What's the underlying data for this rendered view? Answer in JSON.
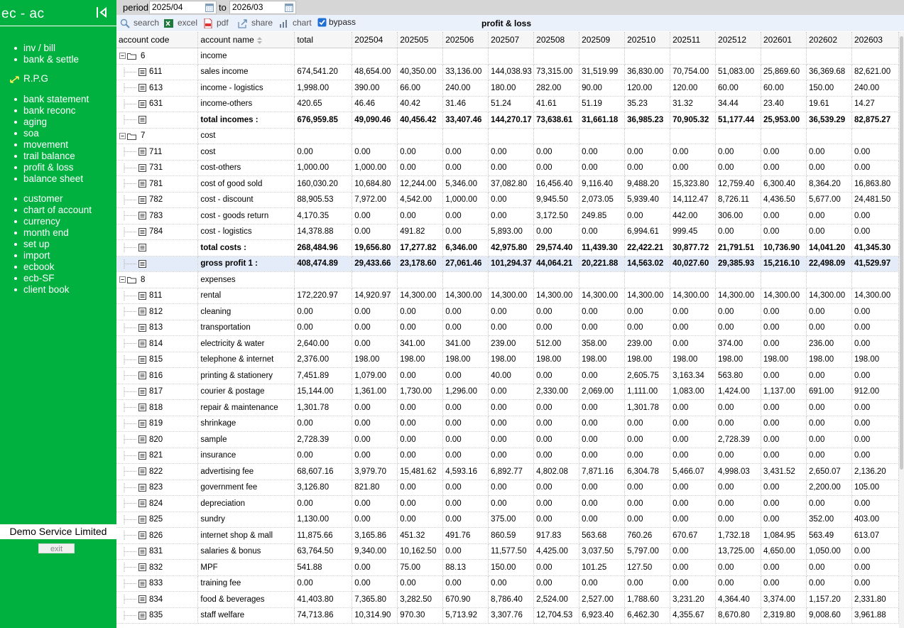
{
  "app": {
    "title": "ec - ac",
    "company": "Demo Service Limited",
    "exit_label": "exit"
  },
  "menu_groups": [
    [
      "inv / bill",
      "bank & settle"
    ],
    [
      "R.P.G"
    ],
    [
      "bank statement",
      "bank reconc",
      "aging",
      "soa",
      "movement",
      "trail balance",
      "profit & loss",
      "balance sheet"
    ],
    [
      "customer",
      "chart of account",
      "currency",
      "month end",
      "set up",
      "import",
      "ecbook",
      "ecb-SF",
      "client book"
    ]
  ],
  "filter": {
    "period_label": "period",
    "from": "2025/04",
    "to_label": "to",
    "to": "2026/03"
  },
  "toolbar": {
    "search": "search",
    "excel": "excel",
    "pdf": "pdf",
    "share": "share",
    "chart": "chart",
    "bypass": "bypass",
    "bypass_checked": true
  },
  "report_title": "profit & loss",
  "columns": [
    "account code",
    "account name",
    "total",
    "202504",
    "202505",
    "202506",
    "202507",
    "202508",
    "202509",
    "202510",
    "202511",
    "202512",
    "202601",
    "202602",
    "202603"
  ],
  "rows": [
    {
      "type": "group",
      "code": "6",
      "name": "income",
      "values": []
    },
    {
      "type": "account",
      "code": "611",
      "name": "sales income",
      "values": [
        "674,541.20",
        "48,654.00",
        "40,350.00",
        "33,136.00",
        "144,038.93",
        "73,315.00",
        "31,519.99",
        "36,830.00",
        "70,754.00",
        "51,083.00",
        "25,869.60",
        "36,369.68",
        "82,621.00"
      ]
    },
    {
      "type": "account",
      "code": "613",
      "name": "income - logistics",
      "values": [
        "1,998.00",
        "390.00",
        "66.00",
        "240.00",
        "180.00",
        "282.00",
        "90.00",
        "120.00",
        "120.00",
        "60.00",
        "60.00",
        "150.00",
        "240.00"
      ]
    },
    {
      "type": "account",
      "code": "631",
      "name": "income-others",
      "values": [
        "420.65",
        "46.46",
        "40.42",
        "31.46",
        "51.24",
        "41.61",
        "51.19",
        "35.23",
        "31.32",
        "34.44",
        "23.40",
        "19.61",
        "14.27"
      ]
    },
    {
      "type": "total",
      "code": "",
      "name": "total incomes :",
      "values": [
        "676,959.85",
        "49,090.46",
        "40,456.42",
        "33,407.46",
        "144,270.17",
        "73,638.61",
        "31,661.18",
        "36,985.23",
        "70,905.32",
        "51,177.44",
        "25,953.00",
        "36,539.29",
        "82,875.27"
      ]
    },
    {
      "type": "group",
      "code": "7",
      "name": "cost",
      "values": []
    },
    {
      "type": "account",
      "code": "711",
      "name": "cost",
      "values": [
        "0.00",
        "0.00",
        "0.00",
        "0.00",
        "0.00",
        "0.00",
        "0.00",
        "0.00",
        "0.00",
        "0.00",
        "0.00",
        "0.00",
        "0.00"
      ]
    },
    {
      "type": "account",
      "code": "731",
      "name": "cost-others",
      "values": [
        "1,000.00",
        "1,000.00",
        "0.00",
        "0.00",
        "0.00",
        "0.00",
        "0.00",
        "0.00",
        "0.00",
        "0.00",
        "0.00",
        "0.00",
        "0.00"
      ]
    },
    {
      "type": "account",
      "code": "781",
      "name": "cost of good sold",
      "values": [
        "160,030.20",
        "10,684.80",
        "12,244.00",
        "5,346.00",
        "37,082.80",
        "16,456.40",
        "9,116.40",
        "9,488.20",
        "15,323.80",
        "12,759.40",
        "6,300.40",
        "8,364.20",
        "16,863.80"
      ]
    },
    {
      "type": "account",
      "code": "782",
      "name": "cost - discount",
      "values": [
        "88,905.53",
        "7,972.00",
        "4,542.00",
        "1,000.00",
        "0.00",
        "9,945.50",
        "2,073.05",
        "5,939.40",
        "14,112.47",
        "8,726.11",
        "4,436.50",
        "5,677.00",
        "24,481.50"
      ]
    },
    {
      "type": "account",
      "code": "783",
      "name": "cost - goods return",
      "values": [
        "4,170.35",
        "0.00",
        "0.00",
        "0.00",
        "0.00",
        "3,172.50",
        "249.85",
        "0.00",
        "442.00",
        "306.00",
        "0.00",
        "0.00",
        "0.00"
      ]
    },
    {
      "type": "account",
      "code": "784",
      "name": "cost - logistics",
      "values": [
        "14,378.88",
        "0.00",
        "491.82",
        "0.00",
        "5,893.00",
        "0.00",
        "0.00",
        "6,994.61",
        "999.45",
        "0.00",
        "0.00",
        "0.00",
        "0.00"
      ]
    },
    {
      "type": "total",
      "code": "",
      "name": "total costs :",
      "values": [
        "268,484.96",
        "19,656.80",
        "17,277.82",
        "6,346.00",
        "42,975.80",
        "29,574.40",
        "11,439.30",
        "22,422.21",
        "30,877.72",
        "21,791.51",
        "10,736.90",
        "14,041.20",
        "41,345.30"
      ]
    },
    {
      "type": "gross",
      "code": "",
      "name": "gross profit 1 :",
      "values": [
        "408,474.89",
        "29,433.66",
        "23,178.60",
        "27,061.46",
        "101,294.37",
        "44,064.21",
        "20,221.88",
        "14,563.02",
        "40,027.60",
        "29,385.93",
        "15,216.10",
        "22,498.09",
        "41,529.97"
      ]
    },
    {
      "type": "group",
      "code": "8",
      "name": "expenses",
      "values": []
    },
    {
      "type": "account",
      "code": "811",
      "name": "rental",
      "values": [
        "172,220.97",
        "14,920.97",
        "14,300.00",
        "14,300.00",
        "14,300.00",
        "14,300.00",
        "14,300.00",
        "14,300.00",
        "14,300.00",
        "14,300.00",
        "14,300.00",
        "14,300.00",
        "14,300.00"
      ]
    },
    {
      "type": "account",
      "code": "812",
      "name": "cleaning",
      "values": [
        "0.00",
        "0.00",
        "0.00",
        "0.00",
        "0.00",
        "0.00",
        "0.00",
        "0.00",
        "0.00",
        "0.00",
        "0.00",
        "0.00",
        "0.00"
      ]
    },
    {
      "type": "account",
      "code": "813",
      "name": "transportation",
      "values": [
        "0.00",
        "0.00",
        "0.00",
        "0.00",
        "0.00",
        "0.00",
        "0.00",
        "0.00",
        "0.00",
        "0.00",
        "0.00",
        "0.00",
        "0.00"
      ]
    },
    {
      "type": "account",
      "code": "814",
      "name": "electricity & water",
      "values": [
        "2,640.00",
        "0.00",
        "341.00",
        "341.00",
        "239.00",
        "512.00",
        "358.00",
        "239.00",
        "0.00",
        "374.00",
        "0.00",
        "236.00",
        "0.00"
      ]
    },
    {
      "type": "account",
      "code": "815",
      "name": "telephone & internet",
      "values": [
        "2,376.00",
        "198.00",
        "198.00",
        "198.00",
        "198.00",
        "198.00",
        "198.00",
        "198.00",
        "198.00",
        "198.00",
        "198.00",
        "198.00",
        "198.00"
      ]
    },
    {
      "type": "account",
      "code": "816",
      "name": "printing & stationery",
      "values": [
        "7,451.89",
        "1,079.00",
        "0.00",
        "0.00",
        "40.00",
        "0.00",
        "0.00",
        "2,605.75",
        "3,163.34",
        "563.80",
        "0.00",
        "0.00",
        "0.00"
      ]
    },
    {
      "type": "account",
      "code": "817",
      "name": "courier & postage",
      "values": [
        "15,144.00",
        "1,361.00",
        "1,730.00",
        "1,296.00",
        "0.00",
        "2,330.00",
        "2,069.00",
        "1,111.00",
        "1,083.00",
        "1,424.00",
        "1,137.00",
        "691.00",
        "912.00"
      ]
    },
    {
      "type": "account",
      "code": "818",
      "name": "repair & maintenance",
      "values": [
        "1,301.78",
        "0.00",
        "0.00",
        "0.00",
        "0.00",
        "0.00",
        "0.00",
        "1,301.78",
        "0.00",
        "0.00",
        "0.00",
        "0.00",
        "0.00"
      ]
    },
    {
      "type": "account",
      "code": "819",
      "name": "shrinkage",
      "values": [
        "0.00",
        "0.00",
        "0.00",
        "0.00",
        "0.00",
        "0.00",
        "0.00",
        "0.00",
        "0.00",
        "0.00",
        "0.00",
        "0.00",
        "0.00"
      ]
    },
    {
      "type": "account",
      "code": "820",
      "name": "sample",
      "values": [
        "2,728.39",
        "0.00",
        "0.00",
        "0.00",
        "0.00",
        "0.00",
        "0.00",
        "0.00",
        "0.00",
        "2,728.39",
        "0.00",
        "0.00",
        "0.00"
      ]
    },
    {
      "type": "account",
      "code": "821",
      "name": "insurance",
      "values": [
        "0.00",
        "0.00",
        "0.00",
        "0.00",
        "0.00",
        "0.00",
        "0.00",
        "0.00",
        "0.00",
        "0.00",
        "0.00",
        "0.00",
        "0.00"
      ]
    },
    {
      "type": "account",
      "code": "822",
      "name": "advertising fee",
      "values": [
        "68,607.16",
        "3,979.70",
        "15,481.62",
        "4,593.16",
        "6,892.77",
        "4,802.08",
        "7,871.16",
        "6,304.78",
        "5,466.07",
        "4,998.03",
        "3,431.52",
        "2,650.07",
        "2,136.20"
      ]
    },
    {
      "type": "account",
      "code": "823",
      "name": "government fee",
      "values": [
        "3,126.80",
        "821.80",
        "0.00",
        "0.00",
        "0.00",
        "0.00",
        "0.00",
        "0.00",
        "0.00",
        "0.00",
        "0.00",
        "2,200.00",
        "105.00"
      ]
    },
    {
      "type": "account",
      "code": "824",
      "name": "depreciation",
      "values": [
        "0.00",
        "0.00",
        "0.00",
        "0.00",
        "0.00",
        "0.00",
        "0.00",
        "0.00",
        "0.00",
        "0.00",
        "0.00",
        "0.00",
        "0.00"
      ]
    },
    {
      "type": "account",
      "code": "825",
      "name": "sundry",
      "values": [
        "1,130.00",
        "0.00",
        "0.00",
        "0.00",
        "375.00",
        "0.00",
        "0.00",
        "0.00",
        "0.00",
        "0.00",
        "0.00",
        "352.00",
        "403.00"
      ]
    },
    {
      "type": "account",
      "code": "826",
      "name": "internet shop & mall",
      "values": [
        "11,875.66",
        "3,165.86",
        "451.32",
        "491.76",
        "860.59",
        "917.83",
        "563.68",
        "760.26",
        "670.67",
        "1,732.18",
        "1,084.95",
        "563.49",
        "613.07"
      ]
    },
    {
      "type": "account",
      "code": "831",
      "name": "salaries & bonus",
      "values": [
        "63,764.50",
        "9,340.00",
        "10,162.50",
        "0.00",
        "11,577.50",
        "4,425.00",
        "3,037.50",
        "5,797.00",
        "0.00",
        "13,725.00",
        "4,650.00",
        "1,050.00",
        "0.00"
      ]
    },
    {
      "type": "account",
      "code": "832",
      "name": "MPF",
      "values": [
        "541.88",
        "0.00",
        "75.00",
        "88.13",
        "150.00",
        "0.00",
        "101.25",
        "127.50",
        "0.00",
        "0.00",
        "0.00",
        "0.00",
        "0.00"
      ]
    },
    {
      "type": "account",
      "code": "833",
      "name": "training fee",
      "values": [
        "0.00",
        "0.00",
        "0.00",
        "0.00",
        "0.00",
        "0.00",
        "0.00",
        "0.00",
        "0.00",
        "0.00",
        "0.00",
        "0.00",
        "0.00"
      ]
    },
    {
      "type": "account",
      "code": "834",
      "name": "food & beverages",
      "values": [
        "41,403.80",
        "7,365.80",
        "3,282.50",
        "670.90",
        "8,786.40",
        "2,524.00",
        "2,527.00",
        "1,788.60",
        "3,231.20",
        "4,364.40",
        "3,374.00",
        "1,157.20",
        "2,331.80"
      ]
    },
    {
      "type": "account",
      "code": "835",
      "name": "staff welfare",
      "values": [
        "74,713.86",
        "10,314.90",
        "970.30",
        "5,713.92",
        "3,307.76",
        "12,704.53",
        "6,923.40",
        "6,462.30",
        "4,355.67",
        "8,670.80",
        "2,319.80",
        "9,008.60",
        "3,961.88"
      ]
    }
  ]
}
